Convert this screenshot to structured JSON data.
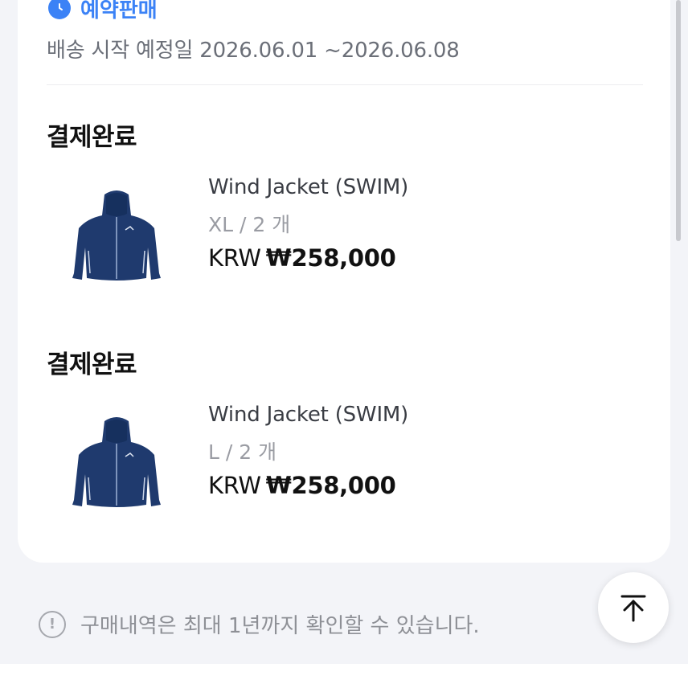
{
  "shipping": {
    "badge_label": "예약판매",
    "date_text": "배송 시작 예정일 2026.06.01 ~2026.06.08"
  },
  "orders": [
    {
      "status": "결제완료",
      "product_name": "Wind Jacket (SWIM)",
      "option": "XL / 2 개",
      "currency": "KRW",
      "price": "₩258,000"
    },
    {
      "status": "결제완료",
      "product_name": "Wind Jacket (SWIM)",
      "option": "L / 2 개",
      "currency": "KRW",
      "price": "₩258,000"
    }
  ],
  "notice": {
    "icon_glyph": "!",
    "text": "구매내역은 최대 1년까지 확인할 수 있습니다."
  },
  "colors": {
    "accent": "#3b82f6",
    "jacket": "#1f3a6e"
  },
  "icons": {
    "badge": "clock-icon",
    "top": "arrow-up-to-top-icon",
    "notice": "info-circle-icon"
  }
}
